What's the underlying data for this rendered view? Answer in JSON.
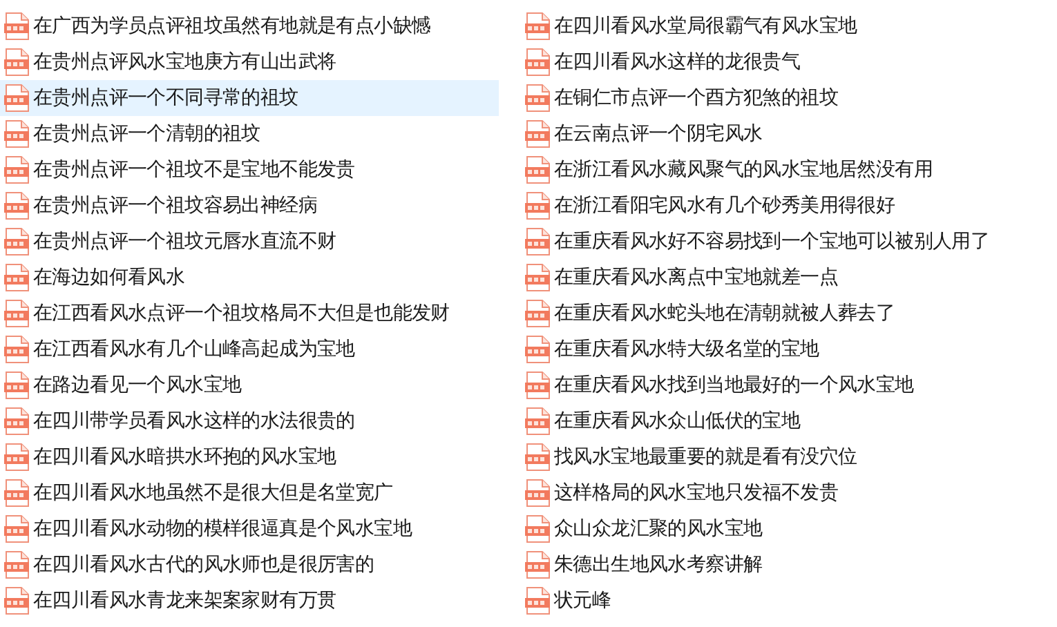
{
  "columns": [
    {
      "files": [
        {
          "name": "在广西为学员点评祖坟虽然有地就是有点小缺憾",
          "selected": false
        },
        {
          "name": "在贵州点评风水宝地庚方有山出武将",
          "selected": false
        },
        {
          "name": "在贵州点评一个不同寻常的祖坟",
          "selected": true
        },
        {
          "name": "在贵州点评一个清朝的祖坟",
          "selected": false
        },
        {
          "name": "在贵州点评一个祖坟不是宝地不能发贵",
          "selected": false
        },
        {
          "name": "在贵州点评一个祖坟容易出神经病",
          "selected": false
        },
        {
          "name": "在贵州点评一个祖坟元唇水直流不财",
          "selected": false
        },
        {
          "name": "在海边如何看风水",
          "selected": false
        },
        {
          "name": "在江西看风水点评一个祖坟格局不大但是也能发财",
          "selected": false
        },
        {
          "name": "在江西看风水有几个山峰高起成为宝地",
          "selected": false
        },
        {
          "name": "在路边看见一个风水宝地",
          "selected": false
        },
        {
          "name": "在四川带学员看风水这样的水法很贵的",
          "selected": false
        },
        {
          "name": "在四川看风水暗拱水环抱的风水宝地",
          "selected": false
        },
        {
          "name": "在四川看风水地虽然不是很大但是名堂宽广",
          "selected": false
        },
        {
          "name": "在四川看风水动物的模样很逼真是个风水宝地",
          "selected": false
        },
        {
          "name": "在四川看风水古代的风水师也是很厉害的",
          "selected": false
        },
        {
          "name": "在四川看风水青龙来架案家财有万贯",
          "selected": false
        }
      ]
    },
    {
      "files": [
        {
          "name": "在四川看风水堂局很霸气有风水宝地",
          "selected": false
        },
        {
          "name": "在四川看风水这样的龙很贵气",
          "selected": false
        },
        {
          "name": "在铜仁市点评一个酉方犯煞的祖坟",
          "selected": false
        },
        {
          "name": "在云南点评一个阴宅风水",
          "selected": false
        },
        {
          "name": "在浙江看风水藏风聚气的风水宝地居然没有用",
          "selected": false
        },
        {
          "name": "在浙江看阳宅风水有几个砂秀美用得很好",
          "selected": false
        },
        {
          "name": "在重庆看风水好不容易找到一个宝地可以被别人用了",
          "selected": false
        },
        {
          "name": "在重庆看风水离点中宝地就差一点",
          "selected": false
        },
        {
          "name": "在重庆看风水蛇头地在清朝就被人葬去了",
          "selected": false
        },
        {
          "name": "在重庆看风水特大级名堂的宝地",
          "selected": false
        },
        {
          "name": "在重庆看风水找到当地最好的一个风水宝地",
          "selected": false
        },
        {
          "name": "在重庆看风水众山低伏的宝地",
          "selected": false
        },
        {
          "name": "找风水宝地最重要的就是看有没穴位",
          "selected": false
        },
        {
          "name": "这样格局的风水宝地只发福不发贵",
          "selected": false
        },
        {
          "name": "众山众龙汇聚的风水宝地",
          "selected": false
        },
        {
          "name": "朱德出生地风水考察讲解",
          "selected": false
        },
        {
          "name": "状元峰",
          "selected": false
        }
      ]
    }
  ]
}
